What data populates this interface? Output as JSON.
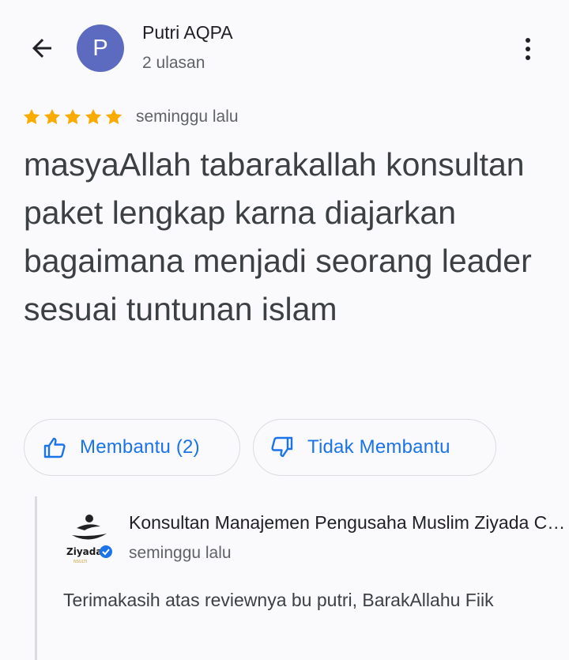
{
  "header": {
    "avatar_letter": "P",
    "avatar_color": "#5c6bc0",
    "user_name": "Putri AQPA",
    "review_count": "2 ulasan"
  },
  "review": {
    "rating": 5,
    "rating_max": 5,
    "star_color": "#f9ab00",
    "date": "seminggu lalu",
    "text": "masyaAllah tabarakallah konsultan paket lengkap karna diajarkan bagaimana menjadi seorang leader sesuai tuntunan islam"
  },
  "actions": {
    "helpful_label": "Membantu (2)",
    "not_helpful_label": "Tidak Membantu",
    "accent_color": "#1a73e8"
  },
  "owner_response": {
    "logo_text": "Ziyada",
    "name": "Konsultan Manajemen Pengusaha Muslim Ziyada Consulting",
    "date": "seminggu lalu",
    "text": "Terimakasih atas reviewnya bu putri, BarakAllahu Fiik"
  }
}
